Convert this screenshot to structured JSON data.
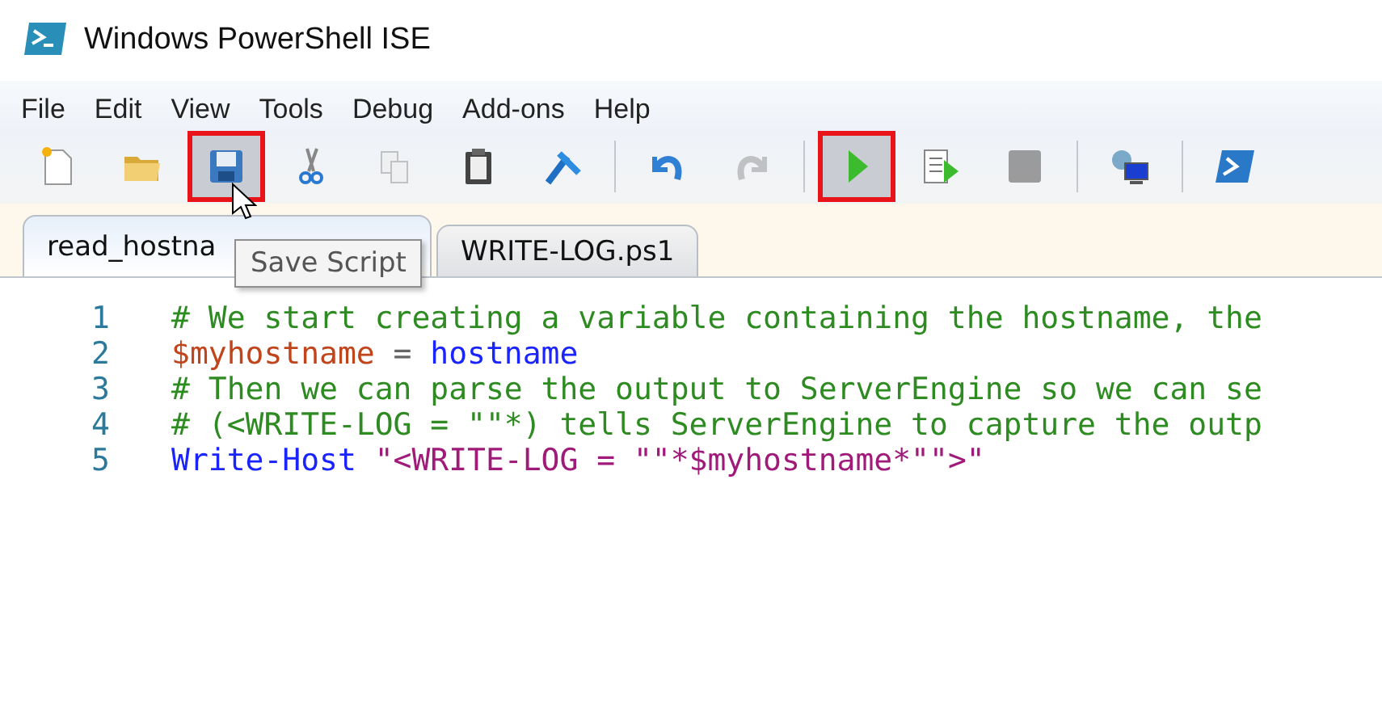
{
  "window": {
    "title": "Windows PowerShell ISE"
  },
  "menu": [
    "File",
    "Edit",
    "View",
    "Tools",
    "Debug",
    "Add-ons",
    "Help"
  ],
  "toolbar": [
    {
      "kind": "new",
      "disabled": false,
      "highlighted": false
    },
    {
      "kind": "open",
      "disabled": false,
      "highlighted": false
    },
    {
      "kind": "save",
      "disabled": false,
      "highlighted": true
    },
    {
      "kind": "cut",
      "disabled": false,
      "highlighted": false
    },
    {
      "kind": "copy",
      "disabled": true,
      "highlighted": false
    },
    {
      "kind": "paste",
      "disabled": false,
      "highlighted": false
    },
    {
      "kind": "clear",
      "disabled": false,
      "highlighted": false
    },
    {
      "kind": "separator"
    },
    {
      "kind": "undo",
      "disabled": false,
      "highlighted": false
    },
    {
      "kind": "redo",
      "disabled": true,
      "highlighted": false
    },
    {
      "kind": "separator"
    },
    {
      "kind": "run",
      "disabled": false,
      "highlighted": true
    },
    {
      "kind": "run-selection",
      "disabled": false,
      "highlighted": false
    },
    {
      "kind": "stop",
      "disabled": true,
      "highlighted": false
    },
    {
      "kind": "separator"
    },
    {
      "kind": "remote",
      "disabled": false,
      "highlighted": false
    },
    {
      "kind": "separator"
    },
    {
      "kind": "console",
      "disabled": false,
      "highlighted": false
    }
  ],
  "tooltip": {
    "text": "Save Script"
  },
  "tabs": [
    {
      "label": "read_hostna",
      "selected": true
    },
    {
      "label": "WRITE-LOG.ps1",
      "selected": false
    }
  ],
  "editor": {
    "lines": [
      {
        "number": "1",
        "tokens": [
          {
            "kind": "comment",
            "text": "# We start creating a variable containing the hostname, the"
          }
        ]
      },
      {
        "number": "2",
        "tokens": [
          {
            "kind": "variable",
            "text": "$myhostname"
          },
          {
            "kind": "operator",
            "text": " = "
          },
          {
            "kind": "command",
            "text": "hostname"
          }
        ]
      },
      {
        "number": "3",
        "tokens": [
          {
            "kind": "comment",
            "text": "# Then we can parse the output to ServerEngine so we can se"
          }
        ]
      },
      {
        "number": "4",
        "tokens": [
          {
            "kind": "comment",
            "text": "# (<WRITE-LOG = \"\"*) tells ServerEngine to capture the outp"
          }
        ]
      },
      {
        "number": "5",
        "tokens": [
          {
            "kind": "command",
            "text": "Write-Host"
          },
          {
            "kind": "string",
            "text": " \"<WRITE-LOG = \"\"*$myhostname*\"\">\""
          }
        ]
      }
    ]
  }
}
